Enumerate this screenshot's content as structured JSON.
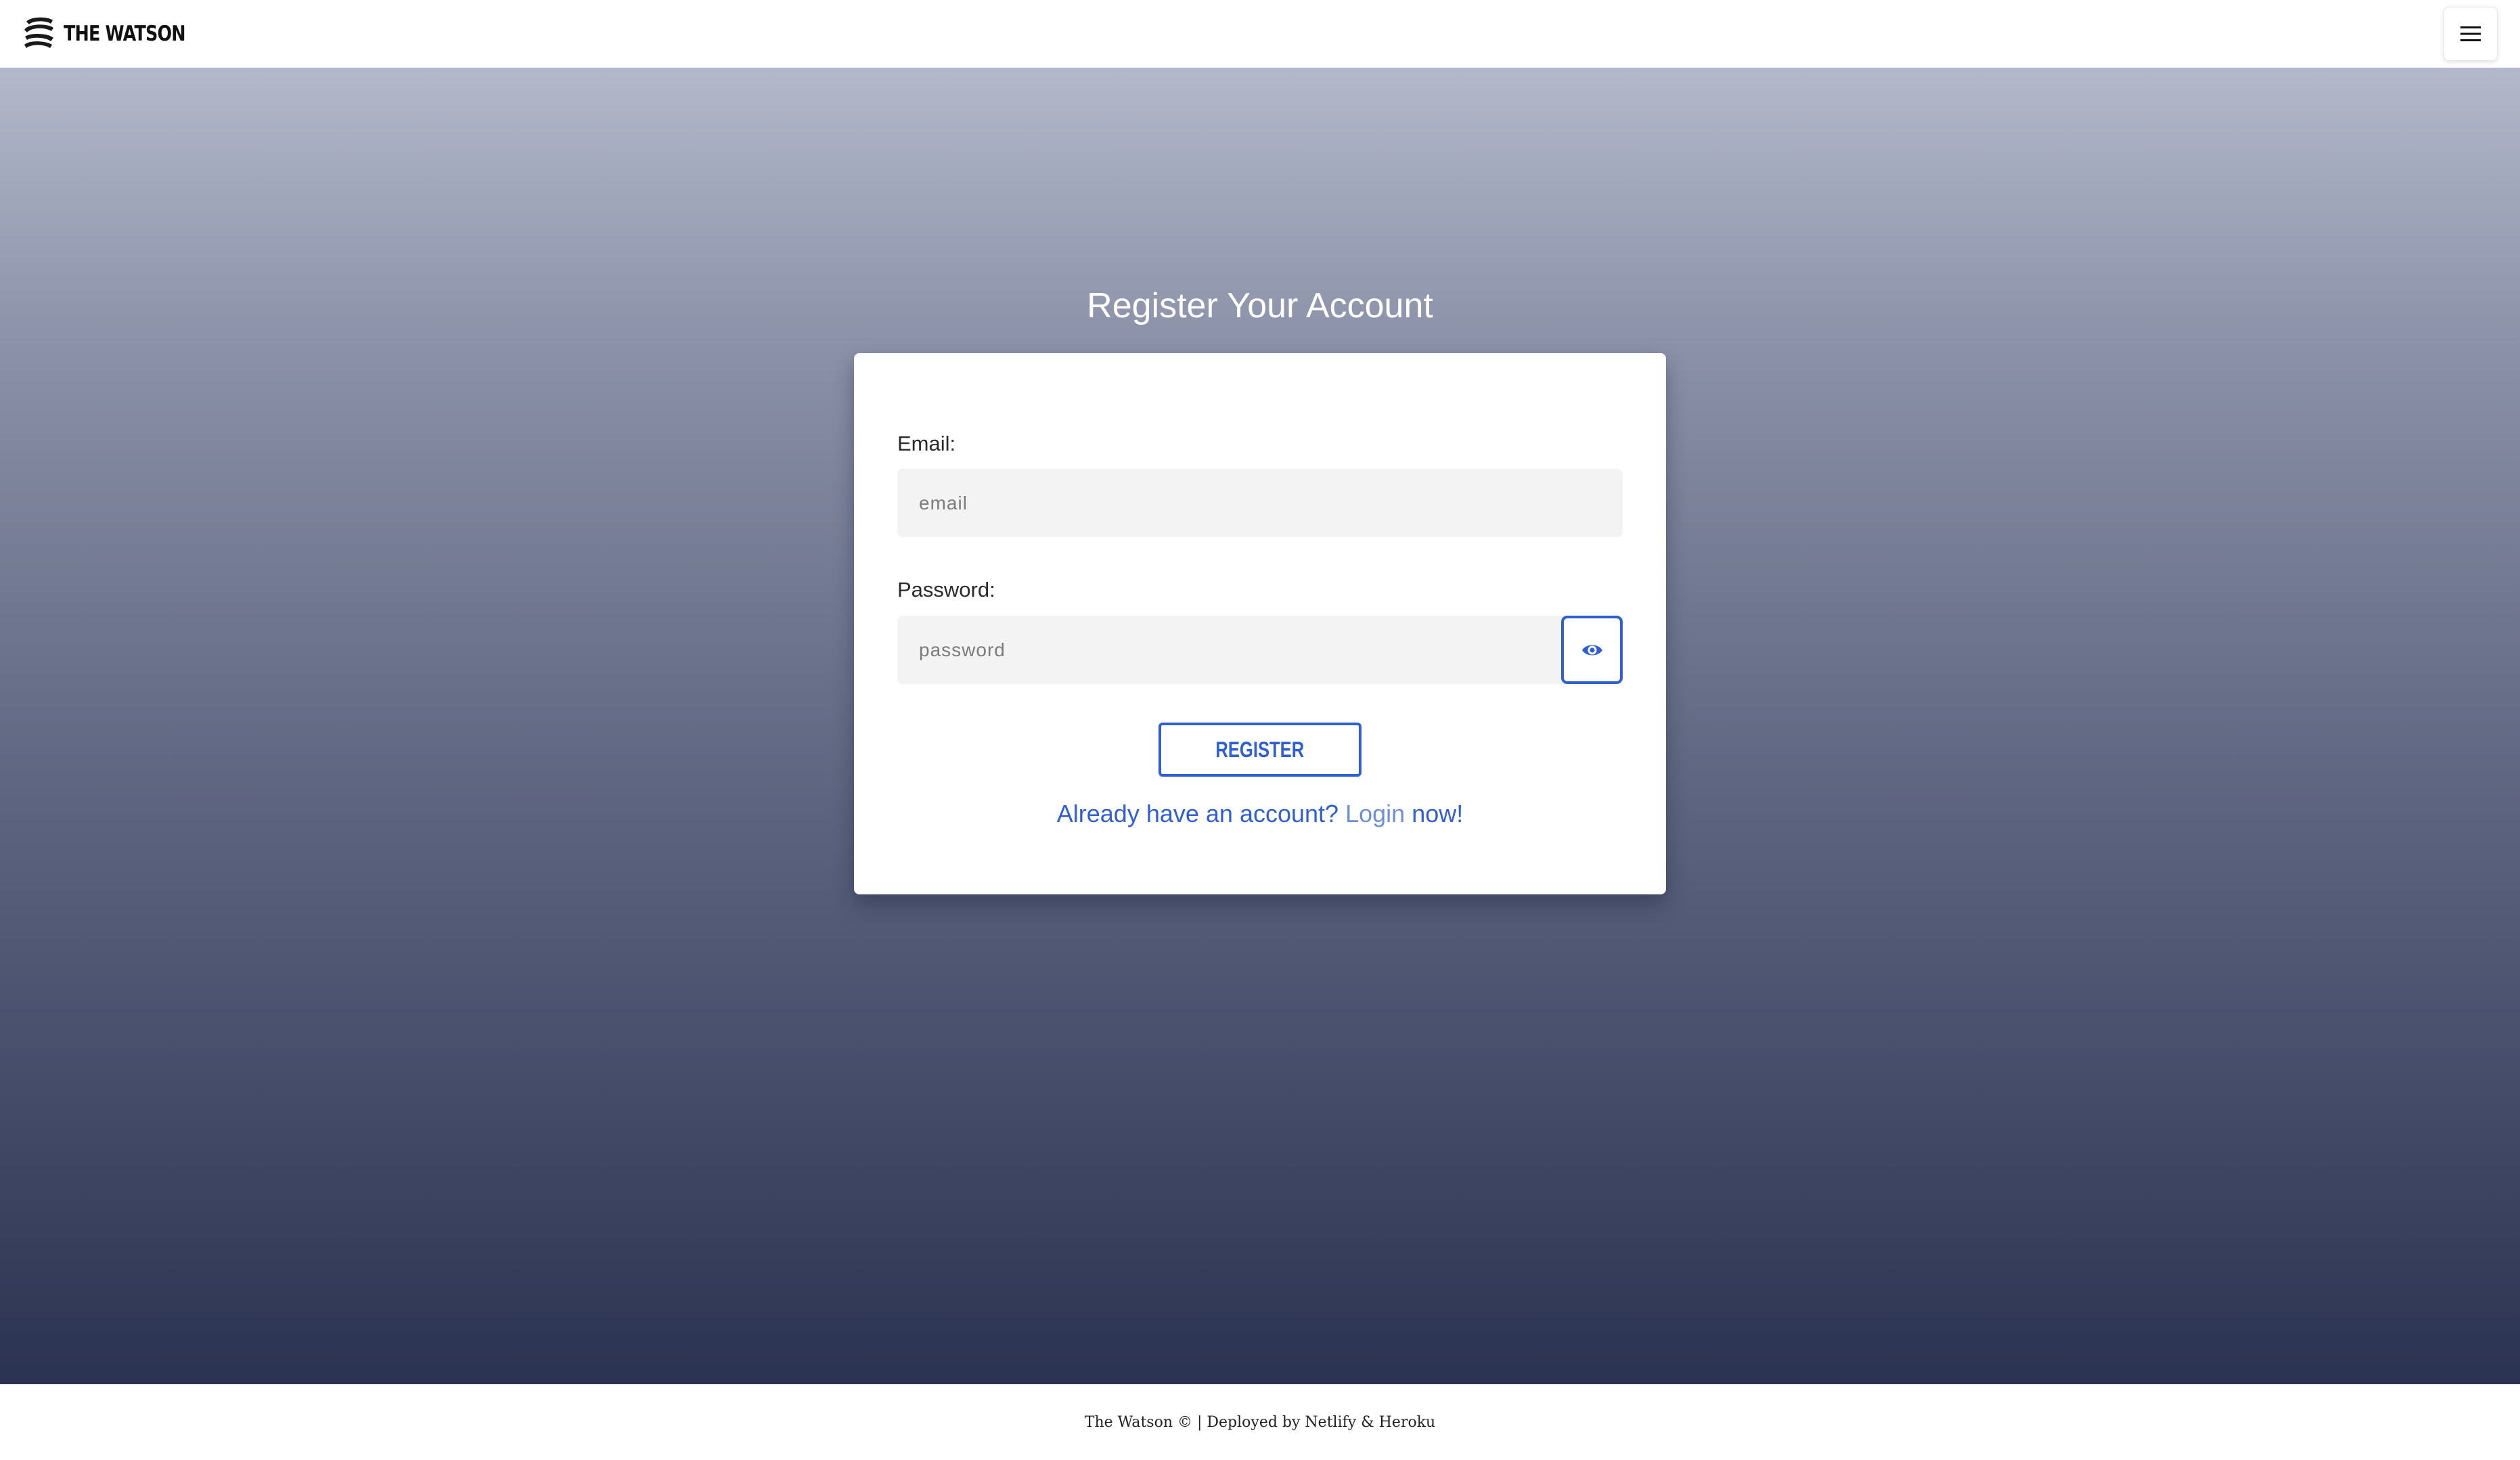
{
  "navbar": {
    "brand_name": "THE WATSON",
    "logo_icon": "striped-s-logo",
    "menu_icon": "hamburger-menu-icon"
  },
  "main": {
    "title": "Register Your Account",
    "email": {
      "label": "Email:",
      "placeholder": "email",
      "value": ""
    },
    "password": {
      "label": "Password:",
      "placeholder": "password",
      "value": "",
      "toggle_icon": "eye-icon"
    },
    "register_label": "REGISTER",
    "login_prompt": {
      "before": "Already have an account?",
      "link": "Login",
      "after": "now!"
    }
  },
  "footer": {
    "text": "The Watson © | Deployed by Netlify & Heroku"
  },
  "colors": {
    "accent": "#2f5fd0",
    "link": "#6f8fd8",
    "gradient_top": "#b3b8ca",
    "gradient_bottom": "#2b3352",
    "input_bg": "#f3f3f3"
  }
}
